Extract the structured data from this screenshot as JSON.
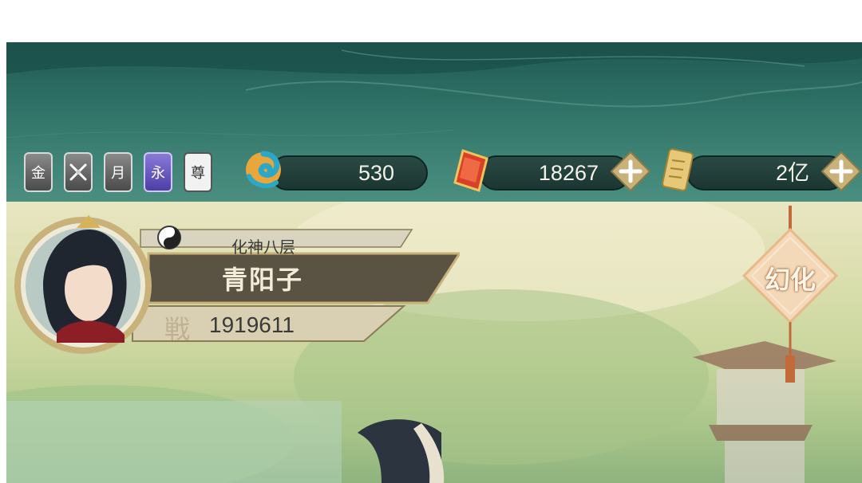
{
  "ranks": [
    {
      "label": "金",
      "style": "grey"
    },
    {
      "label": "",
      "style": "grey",
      "icon": "crossed-swords-icon"
    },
    {
      "label": "月",
      "style": "grey"
    },
    {
      "label": "永",
      "style": "purple"
    },
    {
      "label": "尊",
      "style": "white"
    }
  ],
  "currencies": {
    "spirit_jade": {
      "value": "530",
      "icon": "swirl-orb-icon"
    },
    "red_gem": {
      "value": "18267",
      "icon": "red-crystal-icon"
    },
    "gold_scroll": {
      "value": "2亿",
      "icon": "gold-scroll-icon"
    }
  },
  "player": {
    "realm": "化神八层",
    "name": "青阳子",
    "power_label": "戦",
    "power": "1919611"
  },
  "transform_button": {
    "label": "幻化"
  },
  "colors": {
    "teal": "#2f7166",
    "gold": "#c9b27a",
    "bar": "#1c3632"
  }
}
